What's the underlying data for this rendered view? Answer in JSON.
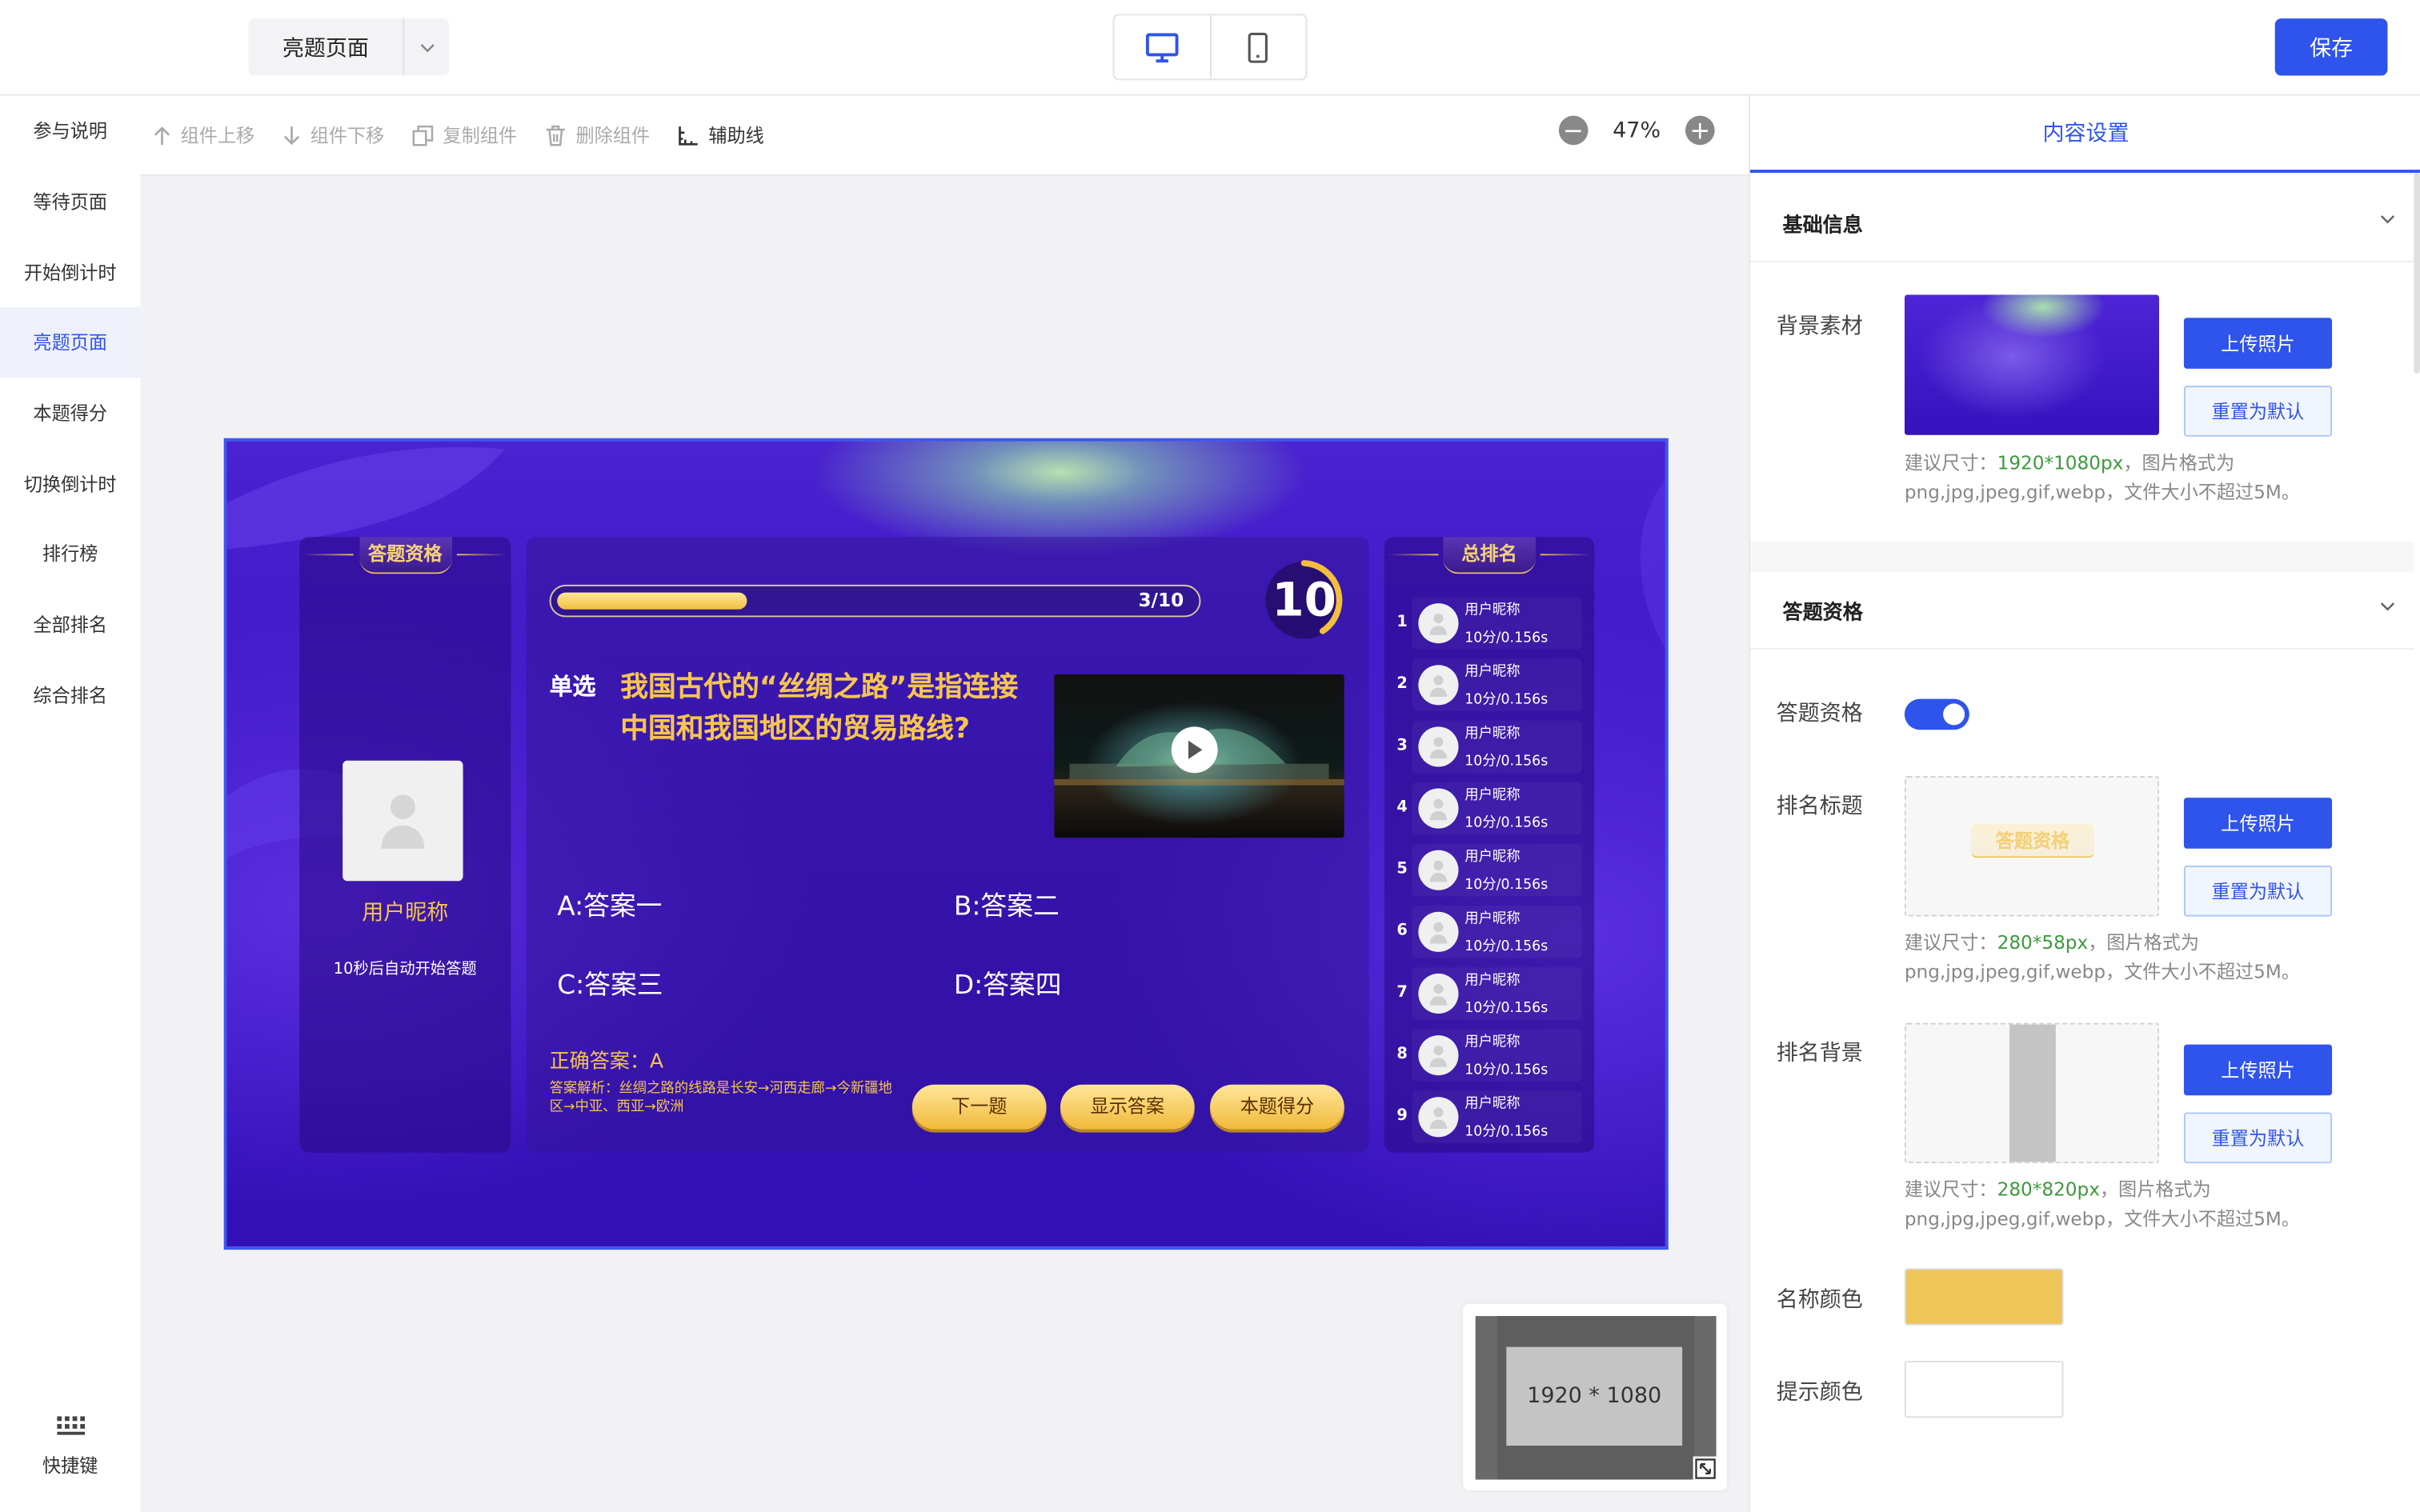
{
  "topbar": {
    "page_select": "亮题页面",
    "save_label": "保存"
  },
  "nav": {
    "items": [
      "参与说明",
      "等待页面",
      "开始倒计时",
      "亮题页面",
      "本题得分",
      "切换倒计时",
      "排行榜",
      "全部排名",
      "综合排名"
    ],
    "active_index": 3,
    "shortcut_label": "快捷键"
  },
  "toolbar": {
    "move_up": "组件上移",
    "move_down": "组件下移",
    "copy": "复制组件",
    "delete": "删除组件",
    "guides": "辅助线",
    "zoom": "47%"
  },
  "stage": {
    "left_title": "答题资格",
    "nickname": "用户昵称",
    "auto_start": "10秒后自动开始答题",
    "progress_text": "3/10",
    "progress_fraction": 0.3,
    "timer": "10",
    "question_type": "单选",
    "question": "我国古代的“丝绸之路”是指连接中国和我国地区的贸易路线?",
    "options": [
      "A:答案一",
      "B:答案二",
      "C:答案三",
      "D:答案四"
    ],
    "correct": "正确答案：A",
    "explanation": "答案解析：丝绸之路的线路是长安→河西走廊→今新疆地区→中亚、西亚→欧洲",
    "buttons": [
      "下一题",
      "显示答案",
      "本题得分"
    ],
    "rank_title": "总排名",
    "ranks": [
      {
        "no": "1",
        "name": "用户昵称",
        "score": "10分/0.156s"
      },
      {
        "no": "2",
        "name": "用户昵称",
        "score": "10分/0.156s"
      },
      {
        "no": "3",
        "name": "用户昵称",
        "score": "10分/0.156s"
      },
      {
        "no": "4",
        "name": "用户昵称",
        "score": "10分/0.156s"
      },
      {
        "no": "5",
        "name": "用户昵称",
        "score": "10分/0.156s"
      },
      {
        "no": "6",
        "name": "用户昵称",
        "score": "10分/0.156s"
      },
      {
        "no": "7",
        "name": "用户昵称",
        "score": "10分/0.156s"
      },
      {
        "no": "8",
        "name": "用户昵称",
        "score": "10分/0.156s"
      },
      {
        "no": "9",
        "name": "用户昵称",
        "score": "10分/0.156s"
      }
    ]
  },
  "minimap": {
    "label": "1920 * 1080"
  },
  "settings": {
    "title": "内容设置",
    "basic_section": "基础信息",
    "bg_label": "背景素材",
    "upload": "上传照片",
    "reset": "重置为默认",
    "bg_hint_pre": "建议尺寸：",
    "bg_hint_size": "1920*1080px",
    "bg_hint_post": "，图片格式为png,jpg,jpeg,gif,webp，文件大小不超过5M。",
    "qual_section": "答题资格",
    "qual_label": "答题资格",
    "qual_enabled": true,
    "rank_title_label": "排名标题",
    "rank_title_image_text": "答题资格",
    "rt_hint_pre": "建议尺寸：",
    "rt_hint_size": "280*58px",
    "rt_hint_post": "，图片格式为png,jpg,jpeg,gif,webp，文件大小不超过5M。",
    "rank_bg_label": "排名背景",
    "rb_hint_pre": "建议尺寸：",
    "rb_hint_size": "280*820px",
    "rb_hint_post": "，图片格式为png,jpg,jpeg,gif,webp，文件大小不超过5M。",
    "name_color_label": "名称颜色",
    "name_color": "#F0C55A",
    "tip_color_label": "提示颜色",
    "tip_color": "#FFFFFF"
  },
  "colors": {
    "accent": "#2F54EB",
    "gold": "#F5C54F"
  }
}
